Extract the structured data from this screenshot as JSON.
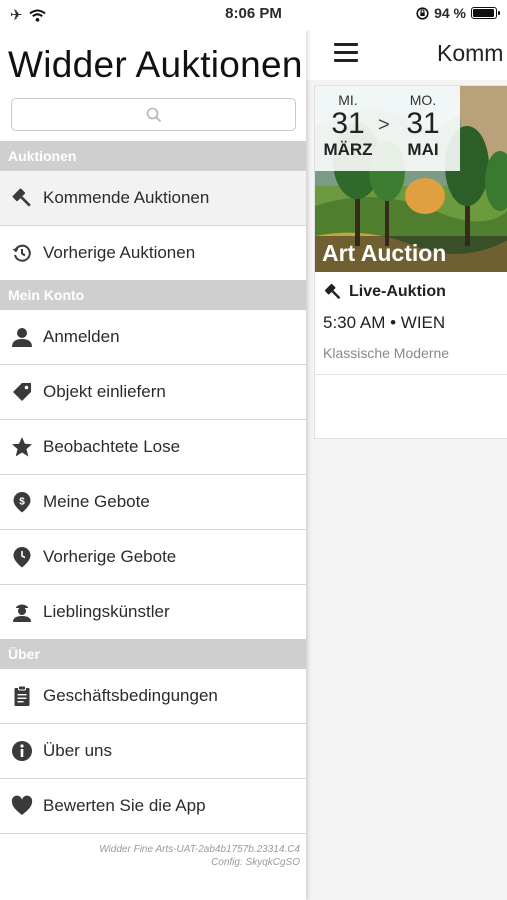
{
  "status_bar": {
    "time": "8:06 PM",
    "battery_text": "94 %",
    "battery_level": 0.94
  },
  "main": {
    "title": "Komm",
    "card": {
      "start": {
        "dow": "MI.",
        "day": "31",
        "month": "MÄRZ"
      },
      "separator": ">",
      "end": {
        "dow": "MO.",
        "day": "31",
        "month": "MAI"
      },
      "caption": "Art Auction",
      "live_label": "Live-Auktion",
      "time_location": "5:30 AM • WIEN",
      "category": "Klassische Moderne"
    }
  },
  "drawer": {
    "title": "Widder Auktionen",
    "search_placeholder": "",
    "sections": {
      "auktionen": "Auktionen",
      "mein_konto": "Mein Konto",
      "ueber": "Über"
    },
    "items": {
      "kommende": "Kommende Auktionen",
      "vorherige": "Vorherige Auktionen",
      "anmelden": "Anmelden",
      "einliefern": "Objekt einliefern",
      "beobachtete": "Beobachtete Lose",
      "gebote": "Meine Gebote",
      "vorherige_gebote": "Vorherige Gebote",
      "kuenstler": "Lieblingskünstler",
      "agb": "Geschäftsbedingungen",
      "ueber_uns": "Über uns",
      "bewerten": "Bewerten Sie die App"
    },
    "footer_line1": "Widder Fine Arts-UAT-2ab4b1757b.23314.C4",
    "footer_line2": "Config: SkyqkCgSO"
  },
  "colors": {
    "section_bg": "#cfcfcf",
    "icon": "#3a3a3a"
  }
}
